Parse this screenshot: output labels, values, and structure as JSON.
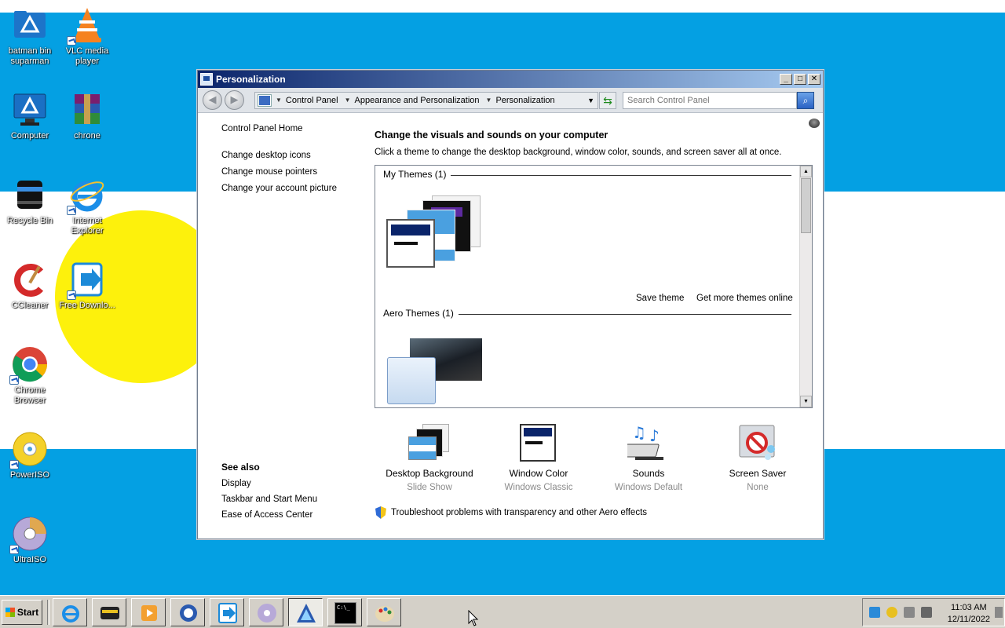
{
  "desktop": {
    "icons": [
      {
        "label": "batman bin suparman",
        "icon": "folder-icon"
      },
      {
        "label": "VLC media player",
        "icon": "vlc-cone-icon"
      },
      {
        "label": "Computer",
        "icon": "computer-icon"
      },
      {
        "label": "chrone",
        "icon": "winrar-archive-icon"
      },
      {
        "label": "Recycle Bin",
        "icon": "recycle-bin-icon"
      },
      {
        "label": "Internet Explorer",
        "icon": "internet-explorer-icon"
      },
      {
        "label": "CCleaner",
        "icon": "ccleaner-icon"
      },
      {
        "label": "Free Downlo...",
        "icon": "free-download-manager-icon"
      },
      {
        "label": "Chrome Browser",
        "icon": "chrome-icon"
      },
      {
        "label": "PowerISO",
        "icon": "poweriso-disc-icon"
      },
      {
        "label": "UltraISO",
        "icon": "ultraiso-disc-icon"
      }
    ]
  },
  "window": {
    "title": "Personalization",
    "controls": {
      "minimize": "_",
      "maximize": "□",
      "close": "✕"
    },
    "address": {
      "crumbs": [
        "Control Panel",
        "Appearance and Personalization",
        "Personalization"
      ]
    },
    "search": {
      "placeholder": "Search Control Panel"
    },
    "sidebar": {
      "home": "Control Panel Home",
      "links": [
        "Change desktop icons",
        "Change mouse pointers",
        "Change your account picture"
      ],
      "see_also_heading": "See also",
      "see_also": [
        "Display",
        "Taskbar and Start Menu",
        "Ease of Access Center"
      ]
    },
    "main": {
      "heading": "Change the visuals and sounds on your computer",
      "subheading": "Click a theme to change the desktop background, window color, sounds, and screen saver all at once.",
      "my_themes": "My Themes (1)",
      "aero_themes": "Aero Themes (1)",
      "save_theme": "Save theme",
      "get_more": "Get more themes online"
    },
    "tasks": [
      {
        "title": "Desktop Background",
        "value": "Slide Show"
      },
      {
        "title": "Window Color",
        "value": "Windows Classic"
      },
      {
        "title": "Sounds",
        "value": "Windows Default"
      },
      {
        "title": "Screen Saver",
        "value": "None"
      }
    ],
    "troubleshoot": "Troubleshoot problems with transparency and other Aero effects"
  },
  "taskbar": {
    "start": "Start",
    "buttons": [
      "internet-explorer-icon",
      "media-center-icon",
      "media-player-icon",
      "app-ring-icon",
      "free-download-manager-icon",
      "disc-icon",
      "personalization-icon",
      "command-prompt-icon",
      "paint-icon"
    ],
    "cmd_text": "C:\\_",
    "clock_time": "11:03 AM",
    "clock_date": "12/11/2022"
  }
}
